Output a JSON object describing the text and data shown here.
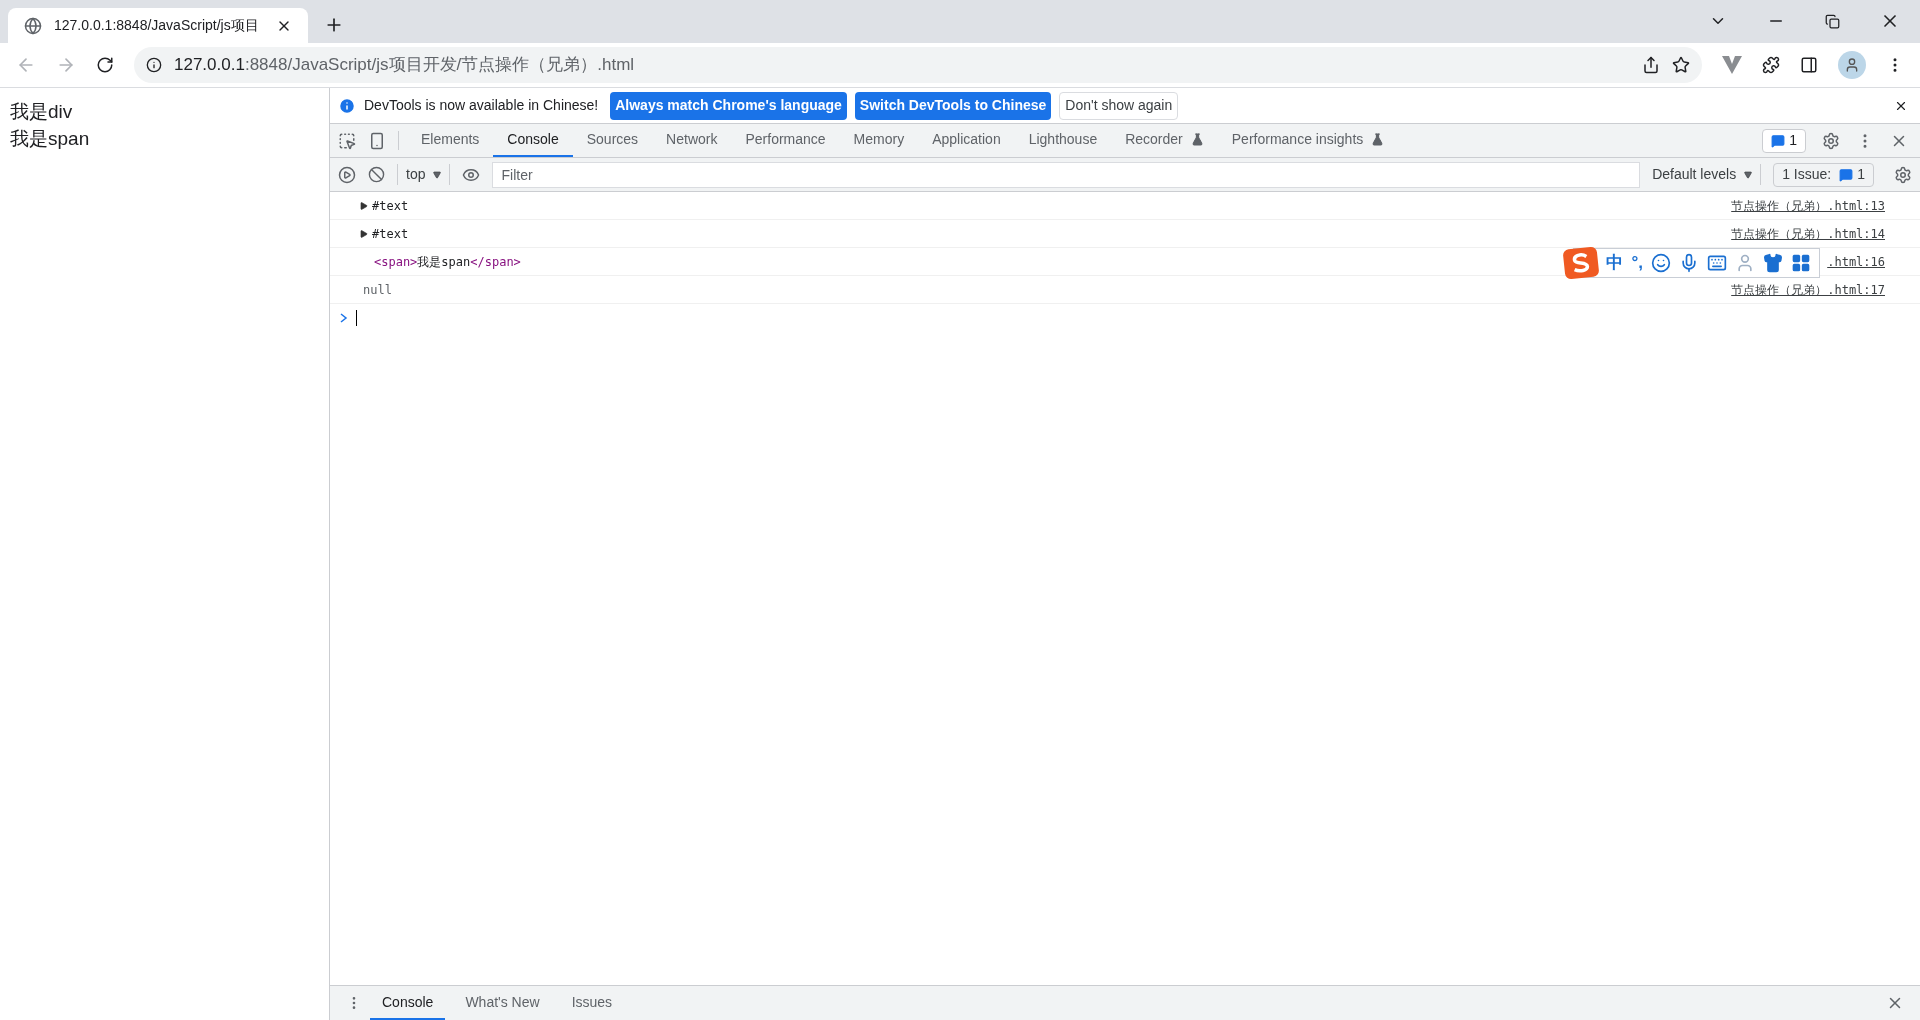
{
  "browser": {
    "tab": {
      "title": "127.0.0.1:8848/JavaScript/js项目"
    },
    "address": {
      "host": "127.0.0.1",
      "path": ":8848/JavaScript/js项目开发/节点操作（兄弟）.html"
    }
  },
  "page": {
    "lines": [
      "我是div",
      "我是span"
    ]
  },
  "devtools": {
    "infobar": {
      "message": "DevTools is now available in Chinese!",
      "buttons": [
        {
          "label": "Always match Chrome's language",
          "kind": "primary"
        },
        {
          "label": "Switch DevTools to Chinese",
          "kind": "primary"
        },
        {
          "label": "Don't show again",
          "kind": "secondary"
        }
      ]
    },
    "tabs": [
      {
        "label": "Elements",
        "selected": false,
        "experimental": false
      },
      {
        "label": "Console",
        "selected": true,
        "experimental": false
      },
      {
        "label": "Sources",
        "selected": false,
        "experimental": false
      },
      {
        "label": "Network",
        "selected": false,
        "experimental": false
      },
      {
        "label": "Performance",
        "selected": false,
        "experimental": false
      },
      {
        "label": "Memory",
        "selected": false,
        "experimental": false
      },
      {
        "label": "Application",
        "selected": false,
        "experimental": false
      },
      {
        "label": "Lighthouse",
        "selected": false,
        "experimental": false
      },
      {
        "label": "Recorder",
        "selected": false,
        "experimental": true
      },
      {
        "label": "Performance insights",
        "selected": false,
        "experimental": true
      }
    ],
    "messages_badge": "1",
    "console_toolbar": {
      "context": "top",
      "filter_placeholder": "Filter",
      "levels": "Default levels",
      "issues": {
        "label": "1 Issue:",
        "count": "1"
      }
    },
    "console_rows": [
      {
        "kind": "expandable",
        "text": "#text",
        "source": "节点操作（兄弟）.html:13"
      },
      {
        "kind": "expandable",
        "text": "#text",
        "source": "节点操作（兄弟）.html:14"
      },
      {
        "kind": "element",
        "open_tag": "<span>",
        "text": "我是span",
        "close_tag": "</span>",
        "source": ".html:16"
      },
      {
        "kind": "null",
        "text": "null",
        "source": "节点操作（兄弟）.html:17"
      }
    ],
    "ime_toolbar": {
      "labels": [
        "中",
        "°,"
      ]
    },
    "drawer_tabs": [
      {
        "label": "Console",
        "selected": true
      },
      {
        "label": "What's New",
        "selected": false
      },
      {
        "label": "Issues",
        "selected": false
      }
    ]
  }
}
